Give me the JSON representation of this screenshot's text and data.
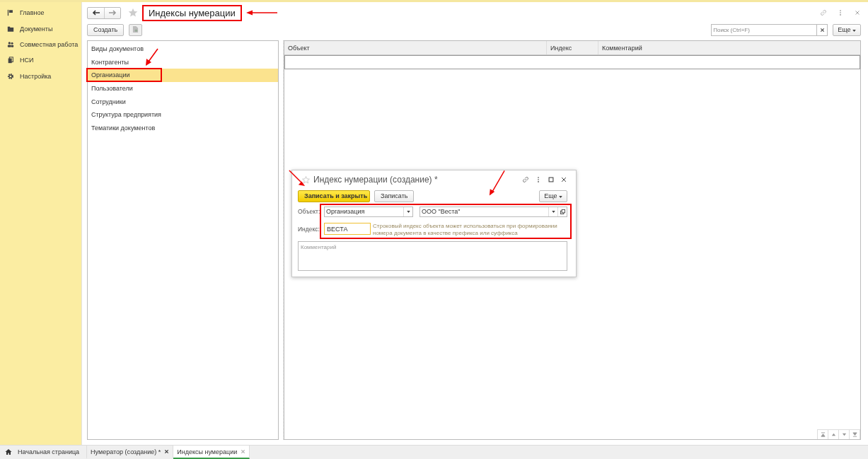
{
  "sidebar": {
    "items": [
      {
        "label": "Главное"
      },
      {
        "label": "Документы"
      },
      {
        "label": "Совместная работа"
      },
      {
        "label": "НСИ"
      },
      {
        "label": "Настройка"
      }
    ]
  },
  "header": {
    "title": "Индексы нумерации",
    "title_highlighted": true,
    "create_button": "Создать",
    "search": {
      "placeholder": "Поиск (Ctrl+F)"
    },
    "more_button": "Еще"
  },
  "list": {
    "items": [
      {
        "label": "Виды документов",
        "selected": false,
        "highlighted": false
      },
      {
        "label": "Контрагенты",
        "selected": false,
        "highlighted": false
      },
      {
        "label": "Организации",
        "selected": true,
        "highlighted": true
      },
      {
        "label": "Пользователи",
        "selected": false,
        "highlighted": false
      },
      {
        "label": "Сотрудники",
        "selected": false,
        "highlighted": false
      },
      {
        "label": "Структура предприятия",
        "selected": false,
        "highlighted": false
      },
      {
        "label": "Тематики документов",
        "selected": false,
        "highlighted": false
      }
    ]
  },
  "table": {
    "columns": [
      "Объект",
      "Индекс",
      "Комментарий"
    ]
  },
  "dialog": {
    "title": "Индекс нумерации (создание) *",
    "save_close_button": "Записать и закрыть",
    "save_button": "Записать",
    "more_button": "Еще",
    "object_label": "Объект:",
    "object_type": "Организация",
    "object_value": "ООО \"Веста\"",
    "index_label": "Индекс:",
    "index_value": "ВЕСТА",
    "hint": "Строковый индекс объекта может использоваться при формировании номера документа в качестве префикса или суффикса",
    "fields_highlighted": true,
    "comment": {
      "placeholder": "Комментарий"
    }
  },
  "taskbar": {
    "home": "Начальная страница",
    "tabs": [
      {
        "label": "Нумератор (создание) *",
        "selected": false
      },
      {
        "label": "Индексы нумерации",
        "selected": true
      }
    ]
  }
}
